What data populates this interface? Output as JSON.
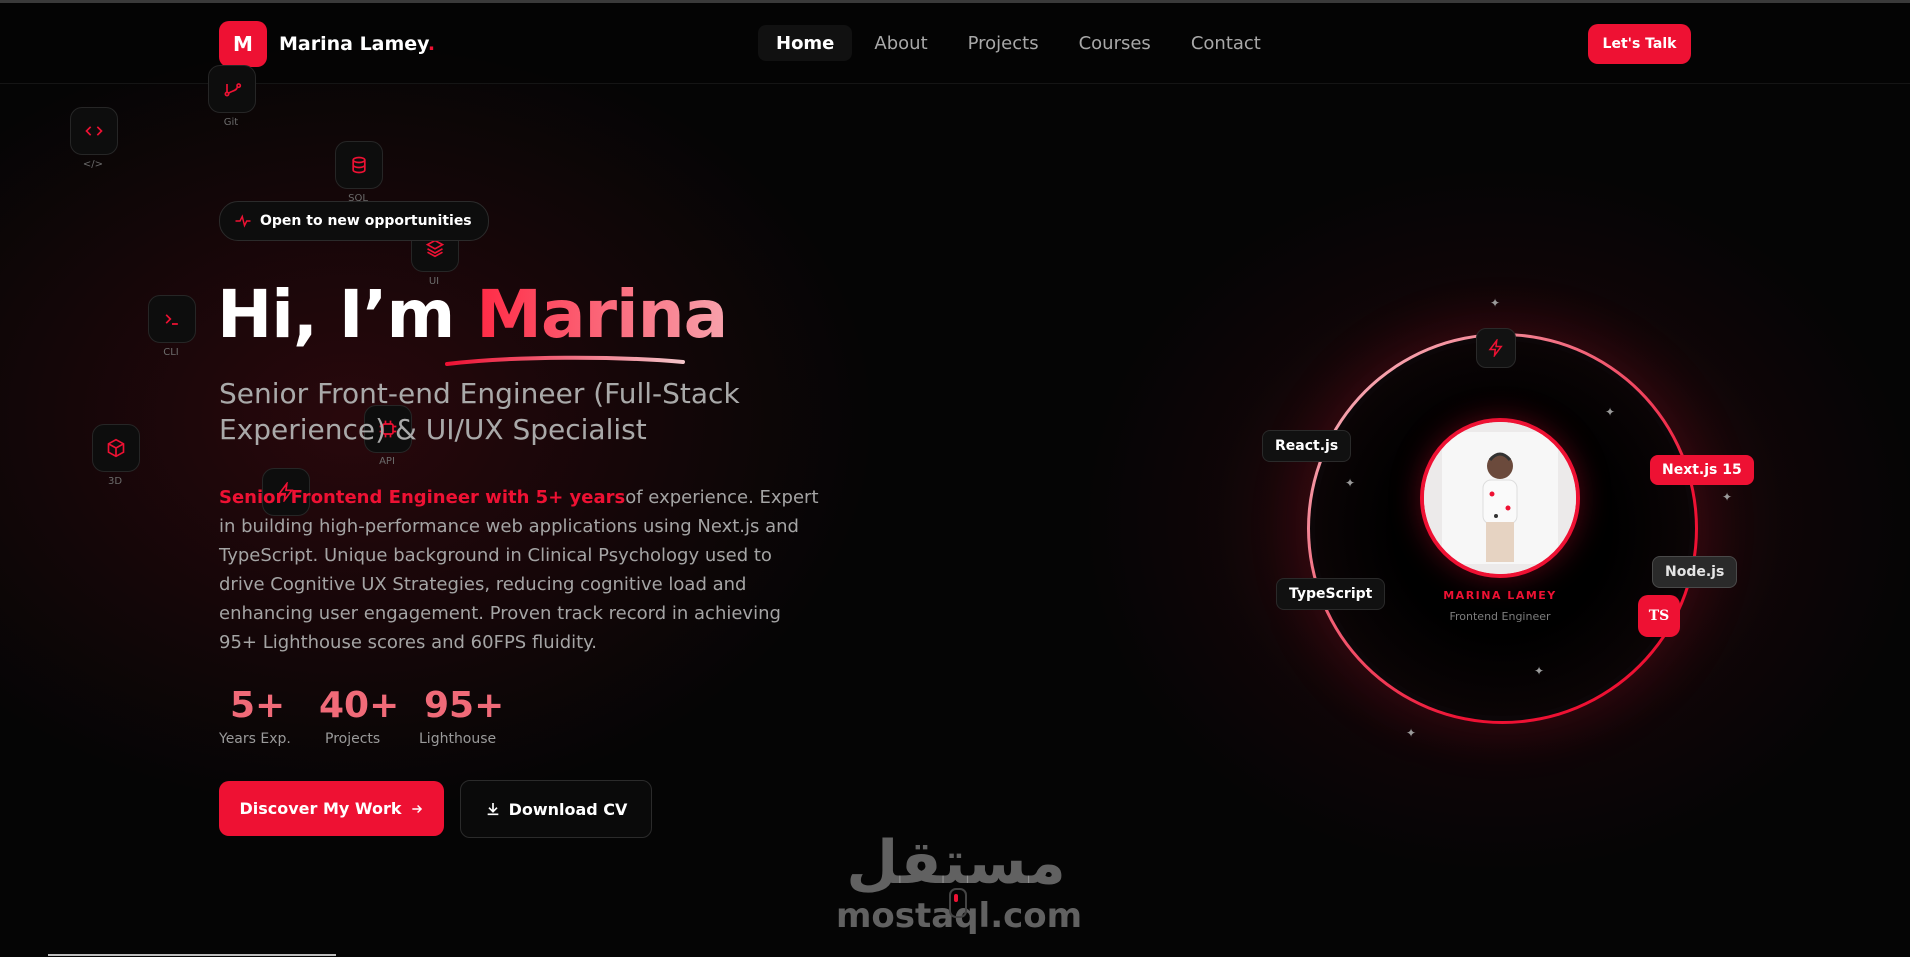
{
  "nav": {
    "logo_letter": "M",
    "logo_name": "Marina Lamey",
    "logo_dot": ".",
    "links": [
      "Home",
      "About",
      "Projects",
      "Courses",
      "Contact"
    ],
    "active": "Home",
    "cta": "Let's Talk"
  },
  "floating_icons": [
    {
      "label": "Git",
      "icon": "git-icon"
    },
    {
      "label": "</>",
      "icon": "code-icon"
    },
    {
      "label": "SQL",
      "icon": "database-icon"
    },
    {
      "label": "UI",
      "icon": "layers-icon"
    },
    {
      "label": "CLI",
      "icon": "terminal-icon"
    },
    {
      "label": "API",
      "icon": "api-icon"
    },
    {
      "label": "3D",
      "icon": "cube-icon"
    },
    {
      "label": "",
      "icon": "bolt-icon"
    }
  ],
  "hero": {
    "badge": "Open to new opportunities",
    "greeting": "Hi, I’m ",
    "name": "Marina",
    "subtitle": "Senior Front-end Engineer (Full-Stack Experience) & UI/UX Specialist",
    "description_highlight": "Senior Frontend Engineer with 5+ years",
    "description_rest": "of experience. Expert in building high-performance web applications using Next.js and TypeScript. Unique background in Clinical Psychology used to drive Cognitive UX Strategies, reducing cognitive load and enhancing user engagement. Proven track record in achieving 95+ Lighthouse scores and 60FPS fluidity.",
    "stats": [
      {
        "value": "5+",
        "label": "Years Exp."
      },
      {
        "value": "40+",
        "label": "Projects"
      },
      {
        "value": "95+",
        "label": "Lighthouse"
      }
    ],
    "primary_button": "Discover My Work",
    "secondary_button": "Download CV"
  },
  "profile": {
    "name": "MARINA LAMEY",
    "role": "Frontend Engineer",
    "tags": {
      "react": "React.js",
      "next": "Next.js 15",
      "node": "Node.js",
      "typescript": "TypeScript",
      "ts": "TS"
    }
  },
  "watermark": {
    "arabic": "مستقل",
    "domain": "mostaql.com"
  },
  "colors": {
    "accent": "#ee1133",
    "background": "#050505",
    "text_muted": "#a4a4a4",
    "stat_color": "#f06a78"
  }
}
